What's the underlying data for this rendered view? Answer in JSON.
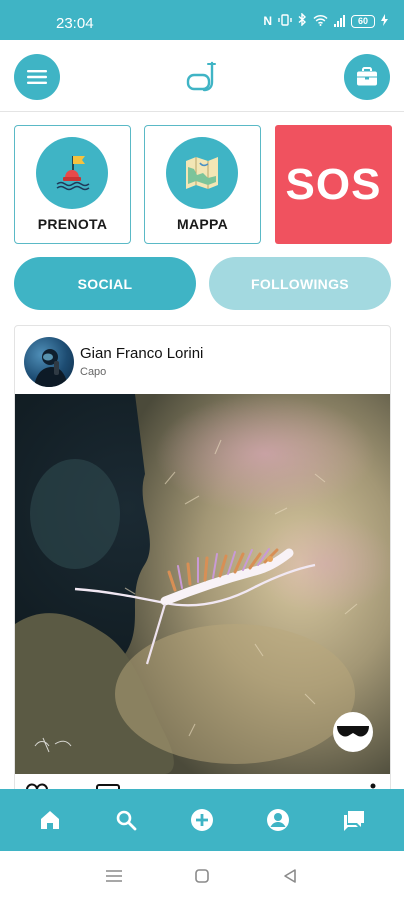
{
  "status_bar": {
    "time": "23:04",
    "battery": "60",
    "icons": [
      "nfc-icon",
      "vibrate-icon",
      "bluetooth-icon",
      "wifi-icon",
      "signal-icon",
      "battery-icon",
      "charging-icon"
    ]
  },
  "app_bar": {
    "menu_icon": "hamburger-menu-icon",
    "logo_icon": "snorkel-mask-logo",
    "right_icon": "briefcase-icon"
  },
  "tiles": [
    {
      "label": "PRENOTA",
      "icon": "buoy-flag-icon"
    },
    {
      "label": "MAPPA",
      "icon": "map-icon"
    }
  ],
  "sos": {
    "label": "SOS"
  },
  "segments": {
    "social": "SOCIAL",
    "followings": "FOLLOWINGS",
    "active": "social"
  },
  "post": {
    "author": "Gian Franco Lorini",
    "role": "Capo",
    "image": "underwater-nudibranch-photo",
    "actions": [
      "heart-icon",
      "comment-icon",
      "more-icon"
    ]
  },
  "bottom_nav": {
    "items": [
      "home-icon",
      "search-icon",
      "add-circle-icon",
      "profile-icon",
      "chat-icon"
    ]
  },
  "system_nav": {
    "items": [
      "recents-icon",
      "home-square-icon",
      "back-triangle-icon"
    ]
  },
  "colors": {
    "accent": "#3fb4c5",
    "accent_light": "#a3d9e0",
    "sos": "#f0525f"
  }
}
